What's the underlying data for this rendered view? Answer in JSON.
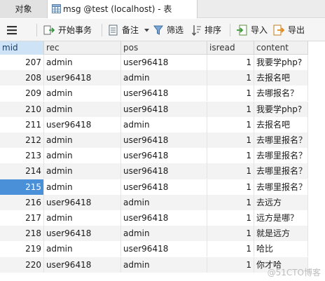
{
  "tabs": {
    "objects": "对象",
    "table": "msg @test (localhost) - 表"
  },
  "toolbar": {
    "begin_transaction": "开始事务",
    "memo": "备注",
    "filter": "筛选",
    "sort": "排序",
    "import": "导入",
    "export": "导出"
  },
  "grid": {
    "columns": [
      "mid",
      "rec",
      "pos",
      "isread",
      "content"
    ],
    "rows": [
      {
        "mid": "207",
        "rec": "admin",
        "pos": "user96418",
        "isread": "1",
        "content": "我要学php?"
      },
      {
        "mid": "208",
        "rec": "user96418",
        "pos": "admin",
        "isread": "1",
        "content": "去报名吧"
      },
      {
        "mid": "209",
        "rec": "admin",
        "pos": "user96418",
        "isread": "1",
        "content": "去哪报名？"
      },
      {
        "mid": "210",
        "rec": "admin",
        "pos": "user96418",
        "isread": "1",
        "content": "我要学php?"
      },
      {
        "mid": "211",
        "rec": "user96418",
        "pos": "admin",
        "isread": "1",
        "content": "去报名吧"
      },
      {
        "mid": "212",
        "rec": "admin",
        "pos": "user96418",
        "isread": "1",
        "content": "去哪里报名？"
      },
      {
        "mid": "213",
        "rec": "admin",
        "pos": "user96418",
        "isread": "1",
        "content": "去哪里报名？"
      },
      {
        "mid": "214",
        "rec": "admin",
        "pos": "user96418",
        "isread": "1",
        "content": "去哪里报名？"
      },
      {
        "mid": "215",
        "rec": "admin",
        "pos": "user96418",
        "isread": "1",
        "content": "去哪里报名？"
      },
      {
        "mid": "216",
        "rec": "user96418",
        "pos": "admin",
        "isread": "1",
        "content": "去远方"
      },
      {
        "mid": "217",
        "rec": "admin",
        "pos": "user96418",
        "isread": "1",
        "content": "远方是哪？"
      },
      {
        "mid": "218",
        "rec": "user96418",
        "pos": "admin",
        "isread": "1",
        "content": "就是远方"
      },
      {
        "mid": "219",
        "rec": "admin",
        "pos": "user96418",
        "isread": "1",
        "content": "哈比"
      },
      {
        "mid": "220",
        "rec": "user96418",
        "pos": "admin",
        "isread": "1",
        "content": "你才哈"
      }
    ],
    "selected_mid": "215"
  },
  "watermark": "@51CTO博客",
  "colors": {
    "selected_cell": "#4a90d9",
    "header_highlight": "#cfe3f6"
  }
}
